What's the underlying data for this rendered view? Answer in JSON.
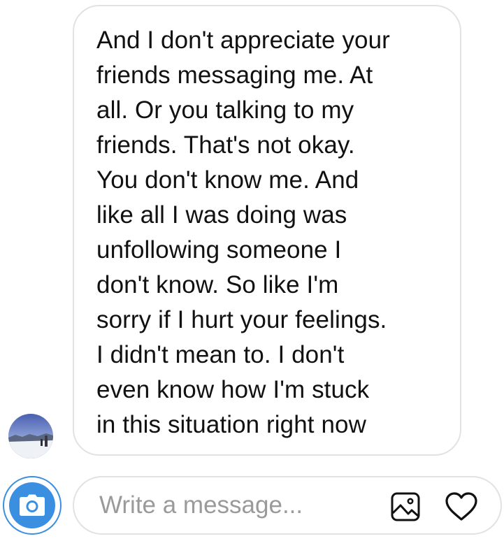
{
  "thread": {
    "message": {
      "text": "And I don't appreciate your\nfriends messaging me. At\nall. Or you talking to my\nfriends. That's not okay.\nYou don't know me. And\nlike all I was doing was\nunfollowing someone I\ndon't know. So like I'm\nsorry if I hurt your feelings.\nI didn't mean to. I don't\neven know how I'm stuck\nin this situation right now",
      "sender_avatar": "profile-photo"
    }
  },
  "composer": {
    "placeholder": "Write a message...",
    "value": "",
    "camera_icon": "camera-icon",
    "gallery_icon": "image-icon",
    "like_icon": "heart-icon"
  },
  "colors": {
    "accent": "#3b8fe0",
    "bubble_border": "#e2e2e2",
    "text": "#111111",
    "placeholder": "#9a9a9a"
  }
}
